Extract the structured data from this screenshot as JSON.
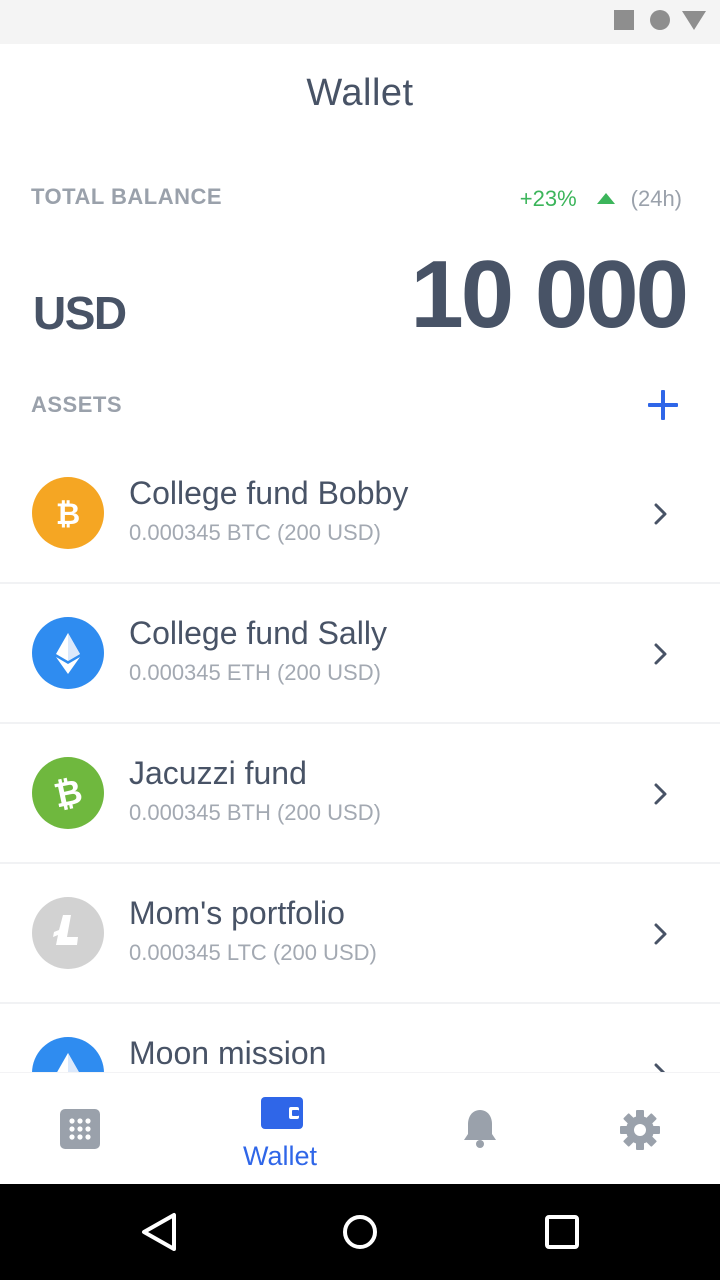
{
  "header": {
    "title": "Wallet"
  },
  "balance": {
    "label": "TOTAL BALANCE",
    "change": "+23%",
    "period": "(24h)",
    "currency": "USD",
    "amount": "10 000"
  },
  "assets": {
    "label": "ASSETS",
    "items": [
      {
        "name": "College fund Bobby",
        "detail": "0.000345 BTC (200 USD)",
        "icon": "bitcoin-icon",
        "color": "#f5a623"
      },
      {
        "name": "College fund Sally",
        "detail": "0.000345 ETH (200 USD)",
        "icon": "ethereum-icon",
        "color": "#2f8cf0"
      },
      {
        "name": "Jacuzzi fund",
        "detail": "0.000345 BTH (200 USD)",
        "icon": "bitcoin-cash-icon",
        "color": "#6fb83e"
      },
      {
        "name": "Mom's portfolio",
        "detail": "0.000345 LTC (200 USD)",
        "icon": "litecoin-icon",
        "color": "#d2d2d2"
      },
      {
        "name": "Moon mission",
        "detail": "",
        "icon": "ethereum-icon",
        "color": "#2f8cf0"
      }
    ]
  },
  "nav": {
    "items": [
      {
        "icon": "apps-grid-icon",
        "label": ""
      },
      {
        "icon": "wallet-icon",
        "label": "Wallet",
        "active": true
      },
      {
        "icon": "bell-icon",
        "label": ""
      },
      {
        "icon": "gear-icon",
        "label": ""
      }
    ]
  },
  "colors": {
    "accent": "#2f66e8",
    "positive": "#3cb55b",
    "text_dark": "#485366",
    "text_muted": "#9aa1ab"
  }
}
